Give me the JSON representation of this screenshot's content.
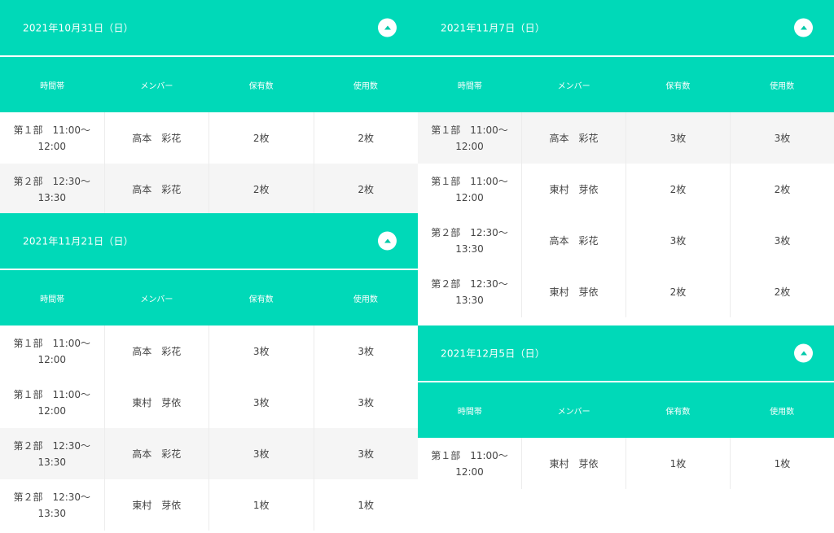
{
  "columns": {
    "time": "時間帯",
    "member": "メンバー",
    "owned": "保有数",
    "used": "使用数"
  },
  "sections": [
    {
      "date": "2021年10月31日（日）",
      "rows": [
        {
          "time1": "第１部　11:00〜",
          "time2": "12:00",
          "member": "高本　彩花",
          "owned": "2枚",
          "used": "2枚"
        },
        {
          "time1": "第２部　12:30〜",
          "time2": "13:30",
          "member": "高本　彩花",
          "owned": "2枚",
          "used": "2枚"
        }
      ]
    },
    {
      "date": "2021年11月21日（日）",
      "rows": [
        {
          "time1": "第１部　11:00〜",
          "time2": "12:00",
          "member": "高本　彩花",
          "owned": "3枚",
          "used": "3枚"
        },
        {
          "time1": "第１部　11:00〜",
          "time2": "12:00",
          "member": "東村　芽依",
          "owned": "3枚",
          "used": "3枚"
        },
        {
          "time1": "第２部　12:30〜",
          "time2": "13:30",
          "member": "高本　彩花",
          "owned": "3枚",
          "used": "3枚"
        },
        {
          "time1": "第２部　12:30〜",
          "time2": "13:30",
          "member": "東村　芽依",
          "owned": "1枚",
          "used": "1枚"
        }
      ]
    },
    {
      "date": "2021年11月7日（日）",
      "rows": [
        {
          "time1": "第１部　11:00〜",
          "time2": "12:00",
          "member": "高本　彩花",
          "owned": "3枚",
          "used": "3枚"
        },
        {
          "time1": "第１部　11:00〜",
          "time2": "12:00",
          "member": "東村　芽依",
          "owned": "2枚",
          "used": "2枚"
        },
        {
          "time1": "第２部　12:30〜",
          "time2": "13:30",
          "member": "高本　彩花",
          "owned": "3枚",
          "used": "3枚"
        },
        {
          "time1": "第２部　12:30〜",
          "time2": "13:30",
          "member": "東村　芽依",
          "owned": "2枚",
          "used": "2枚"
        }
      ]
    },
    {
      "date": "2021年12月5日（日）",
      "rows": [
        {
          "time1": "第１部　11:00〜",
          "time2": "12:00",
          "member": "東村　芽依",
          "owned": "1枚",
          "used": "1枚"
        }
      ]
    }
  ],
  "icons": {
    "toggle": "chevron-up-icon"
  },
  "colors": {
    "accent": "#00d9b8",
    "alt_row": "#f5f5f5"
  }
}
